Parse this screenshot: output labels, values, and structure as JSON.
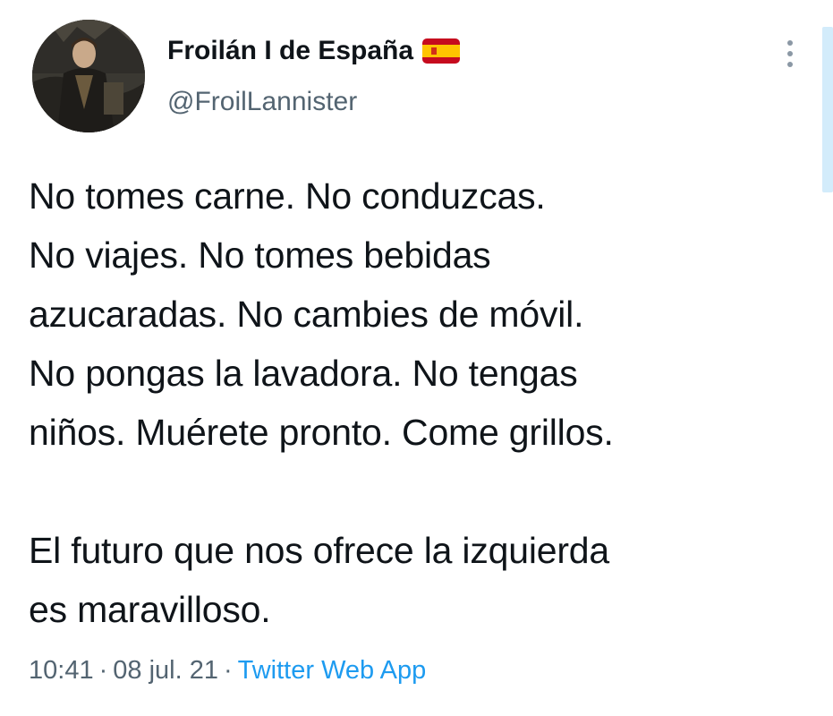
{
  "author": {
    "display_name": "Froilán I de España",
    "flag_icon": "spain-flag-icon",
    "handle": "@FroilLannister"
  },
  "tweet": {
    "text": "No tomes carne. No conduzcas.\nNo viajes. No tomes bebidas\nazucaradas. No cambies de móvil.\nNo pongas la lavadora. No tengas\nniños. Muérete pronto. Come grillos.\n\nEl futuro que nos ofrece la izquierda\nes maravilloso."
  },
  "meta": {
    "time": "10:41",
    "separator": "·",
    "date": "08 jul. 21",
    "source": "Twitter Web App"
  },
  "colors": {
    "text": "#0f1419",
    "secondary": "#536471",
    "link": "#1d9bf0"
  }
}
